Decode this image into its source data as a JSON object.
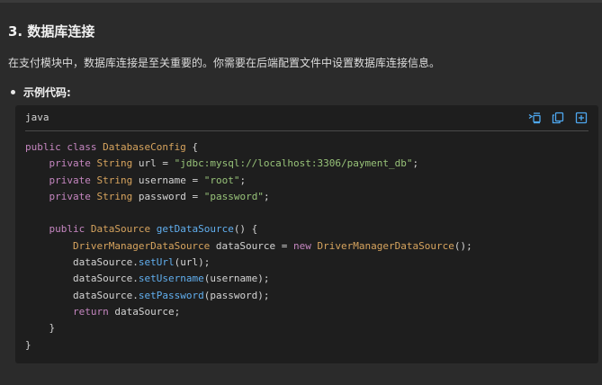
{
  "section": {
    "title": "3. 数据库连接",
    "paragraph": "在支付模块中，数据库连接是至关重要的。你需要在后端配置文件中设置数据库连接信息。",
    "bullet_label": "示例代码:"
  },
  "code_block": {
    "language": "java",
    "actions": [
      {
        "name": "wrap-lines-icon"
      },
      {
        "name": "copy-icon"
      },
      {
        "name": "insert-icon"
      }
    ],
    "lines": [
      [
        {
          "t": "public class ",
          "c": "kw"
        },
        {
          "t": "DatabaseConfig",
          "c": "typ"
        },
        {
          "t": " {",
          "c": "plain"
        }
      ],
      [
        {
          "t": "    private ",
          "c": "kw"
        },
        {
          "t": "String",
          "c": "typ"
        },
        {
          "t": " url = ",
          "c": "plain"
        },
        {
          "t": "\"jdbc:mysql://localhost:3306/payment_db\"",
          "c": "str"
        },
        {
          "t": ";",
          "c": "plain"
        }
      ],
      [
        {
          "t": "    private ",
          "c": "kw"
        },
        {
          "t": "String",
          "c": "typ"
        },
        {
          "t": " username = ",
          "c": "plain"
        },
        {
          "t": "\"root\"",
          "c": "str"
        },
        {
          "t": ";",
          "c": "plain"
        }
      ],
      [
        {
          "t": "    private ",
          "c": "kw"
        },
        {
          "t": "String",
          "c": "typ"
        },
        {
          "t": " password = ",
          "c": "plain"
        },
        {
          "t": "\"password\"",
          "c": "str"
        },
        {
          "t": ";",
          "c": "plain"
        }
      ],
      [
        {
          "t": "",
          "c": "plain"
        }
      ],
      [
        {
          "t": "    public ",
          "c": "kw"
        },
        {
          "t": "DataSource",
          "c": "typ"
        },
        {
          "t": " ",
          "c": "plain"
        },
        {
          "t": "getDataSource",
          "c": "fn"
        },
        {
          "t": "() {",
          "c": "plain"
        }
      ],
      [
        {
          "t": "        ",
          "c": "plain"
        },
        {
          "t": "DriverManagerDataSource",
          "c": "typ"
        },
        {
          "t": " dataSource = ",
          "c": "plain"
        },
        {
          "t": "new ",
          "c": "kw"
        },
        {
          "t": "DriverManagerDataSource",
          "c": "typ"
        },
        {
          "t": "();",
          "c": "plain"
        }
      ],
      [
        {
          "t": "        dataSource.",
          "c": "plain"
        },
        {
          "t": "setUrl",
          "c": "fn"
        },
        {
          "t": "(url);",
          "c": "plain"
        }
      ],
      [
        {
          "t": "        dataSource.",
          "c": "plain"
        },
        {
          "t": "setUsername",
          "c": "fn"
        },
        {
          "t": "(username);",
          "c": "plain"
        }
      ],
      [
        {
          "t": "        dataSource.",
          "c": "plain"
        },
        {
          "t": "setPassword",
          "c": "fn"
        },
        {
          "t": "(password);",
          "c": "plain"
        }
      ],
      [
        {
          "t": "        ",
          "c": "plain"
        },
        {
          "t": "return ",
          "c": "kw"
        },
        {
          "t": "dataSource;",
          "c": "plain"
        }
      ],
      [
        {
          "t": "    }",
          "c": "plain"
        }
      ],
      [
        {
          "t": "}",
          "c": "plain"
        }
      ]
    ]
  },
  "colors": {
    "background": "#2b2b2b",
    "code_background": "#1e1e1e",
    "keyword": "#c586c0",
    "type": "#d7a45e",
    "function": "#61afef",
    "string": "#98c379",
    "icon_accent": "#4ea8f0"
  }
}
